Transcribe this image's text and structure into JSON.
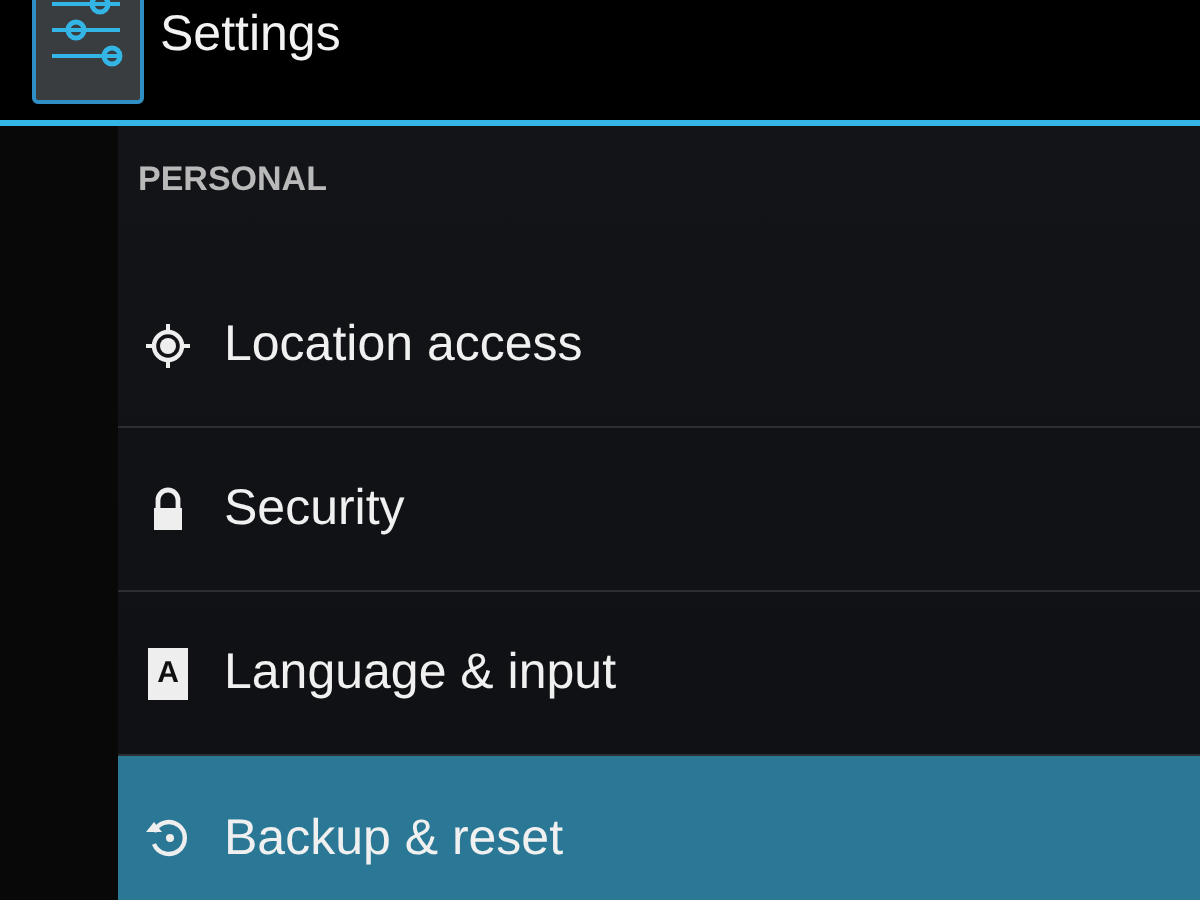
{
  "action_bar": {
    "title": "Settings"
  },
  "section": {
    "header": "PERSONAL"
  },
  "items": [
    {
      "kind": "location",
      "label": "Location access",
      "selected": false
    },
    {
      "kind": "lock",
      "label": "Security",
      "selected": false
    },
    {
      "kind": "language",
      "label": "Language & input",
      "icon_text": "A",
      "selected": false
    },
    {
      "kind": "backup",
      "label": "Backup & reset",
      "selected": true
    }
  ]
}
